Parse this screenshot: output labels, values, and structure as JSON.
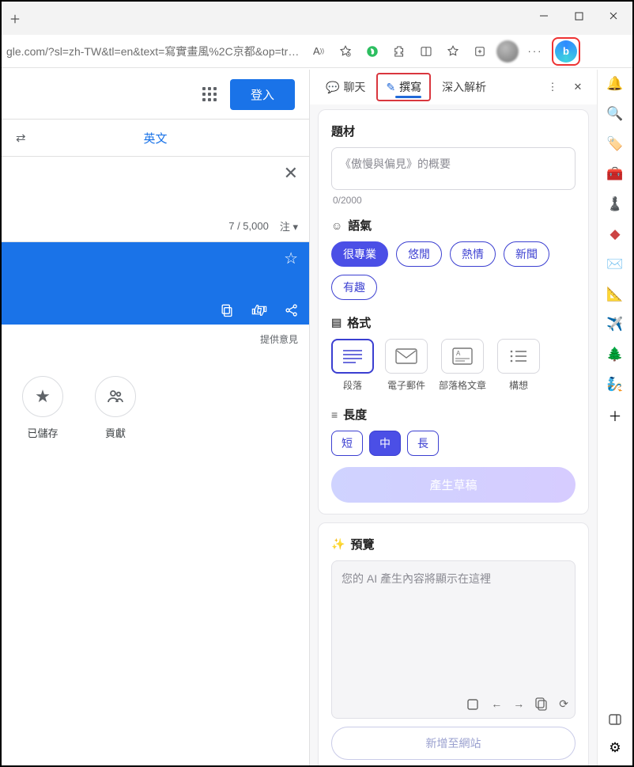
{
  "window": {
    "url": "gle.com/?sl=zh-TW&tl=en&text=寫實畫風%2C京都&op=transl..."
  },
  "translate": {
    "signin": "登入",
    "target_lang": "英文",
    "char_count": "7 / 5,000",
    "notes_label": "注",
    "feedback": "提供意見",
    "saved": "已儲存",
    "contribute": "貢獻"
  },
  "compose": {
    "tabs": {
      "chat": "聊天",
      "compose": "撰寫",
      "insights": "深入解析"
    },
    "topic_label": "題材",
    "topic_placeholder": "《傲慢與偏見》的概要",
    "topic_count": "0/2000",
    "tone_label": "語氣",
    "tones": {
      "professional": "很專業",
      "casual": "悠閒",
      "enthusiastic": "熱情",
      "news": "新聞",
      "funny": "有趣"
    },
    "format_label": "格式",
    "formats": {
      "paragraph": "段落",
      "email": "電子郵件",
      "blog": "部落格文章",
      "ideas": "構想"
    },
    "length_label": "長度",
    "lengths": {
      "short": "短",
      "medium": "中",
      "long": "長"
    },
    "generate": "產生草稿",
    "preview_label": "預覽",
    "preview_placeholder": "您的 AI 產生內容將顯示在這裡",
    "add_to_site": "新增至網站"
  }
}
